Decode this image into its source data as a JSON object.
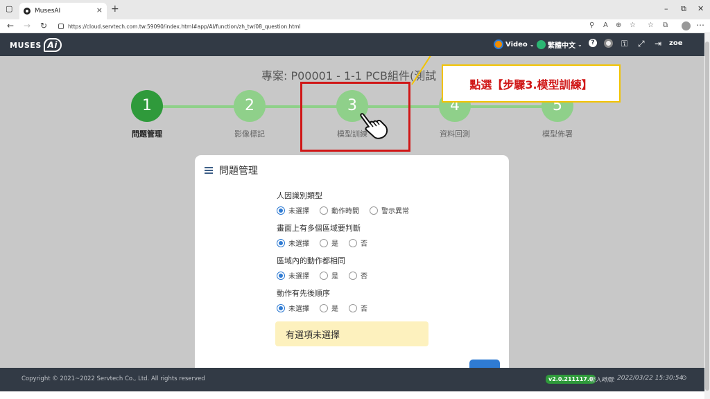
{
  "browser": {
    "tab_title": "MusesAI",
    "tab_close": "×",
    "new_tab": "+",
    "url": "https://cloud.servtech.com.tw:59090/index.html#app/AI/function/zh_tw/08_question.html"
  },
  "header": {
    "logo_text": "MUSES",
    "logo_ai": "Ai",
    "video_label": "Video",
    "language_label": "繁體中文",
    "username": "zoe"
  },
  "page": {
    "project_title": "專案: P00001 - 1-1 PCB組件(測試"
  },
  "steps": [
    {
      "number": "1",
      "label": "問題管理"
    },
    {
      "number": "2",
      "label": "影像標記"
    },
    {
      "number": "3",
      "label": "模型訓練"
    },
    {
      "number": "4",
      "label": "資料回測"
    },
    {
      "number": "5",
      "label": "模型佈署"
    }
  ],
  "callout": {
    "text": "點選【步驟3.模型訓練】"
  },
  "card": {
    "title": "問題管理",
    "questions": [
      {
        "label": "人因識別類型",
        "options": [
          "未選擇",
          "動作時間",
          "警示異常"
        ],
        "selected": 0
      },
      {
        "label": "畫面上有多個區域要判斷",
        "options": [
          "未選擇",
          "是",
          "否"
        ],
        "selected": 0
      },
      {
        "label": "區域內的動作都相同",
        "options": [
          "未選擇",
          "是",
          "否"
        ],
        "selected": 0
      },
      {
        "label": "動作有先後順序",
        "options": [
          "未選擇",
          "是",
          "否"
        ],
        "selected": 0
      }
    ],
    "warning": "有選項未選擇"
  },
  "footer": {
    "copyright": "Copyright © 2021~2022 Servtech Co., Ltd. All rights reserved",
    "version": "v2.0.211117.0",
    "login_label": "登入時間:",
    "login_time": "2022/03/22 15:30:54"
  },
  "colors": {
    "header_bg": "#323a45",
    "step_active": "#2f9a3b",
    "step_inactive": "#8fd08a",
    "highlight_red": "#d01717",
    "callout_border": "#f2c300",
    "radio_blue": "#2f7bd3",
    "warning_bg": "#fdf1be"
  }
}
